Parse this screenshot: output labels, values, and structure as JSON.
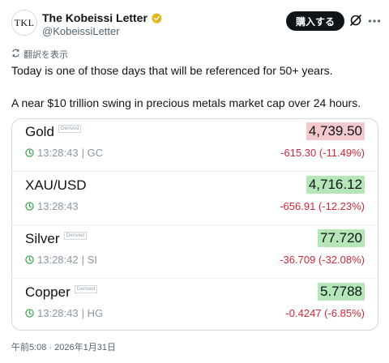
{
  "author": {
    "display_name": "The Kobeissi Letter",
    "handle": "@KobeissiLetter",
    "avatar_text": "TKL",
    "subscribe_label": "購入する"
  },
  "tweet": {
    "translate_label": "翻訳を表示",
    "line1": "Today is one of those days that will be referenced for 50+ years.",
    "line2": "A near $10 trillion swing in precious metals market cap over 24 hours.",
    "timestamp": "午前5:08 · 2026年1月31日"
  },
  "quotes": [
    {
      "name": "Gold",
      "derived": "Derived",
      "price": "4,739.50",
      "time": "13:28:43",
      "symbol": "| GC",
      "change": "-615.30 (-11.49%)",
      "highlight": "down"
    },
    {
      "name": "XAU/USD",
      "derived": "",
      "price": "4,716.12",
      "time": "13:28:43",
      "symbol": "",
      "change": "-656.91 (-12.23%)",
      "highlight": "up"
    },
    {
      "name": "Silver",
      "derived": "Derived",
      "price": "77.720",
      "time": "13:28:42",
      "symbol": "| SI",
      "change": "-36.709 (-32.08%)",
      "highlight": "up"
    },
    {
      "name": "Copper",
      "derived": "Derived",
      "price": "5.7788",
      "time": "13:28:43",
      "symbol": "| HG",
      "change": "-0.4247 (-6.85%)",
      "highlight": "up"
    }
  ],
  "colors": {
    "negative": "#d0283a",
    "price_down_bg": "#f4c9cd",
    "price_up_bg": "#b5e6b8",
    "verified_badge": "#e2b719",
    "clock": "#2f9e44"
  },
  "icons": [
    "verified-badge-icon",
    "grok-icon",
    "more-icon",
    "translate-icon",
    "clock-icon"
  ]
}
